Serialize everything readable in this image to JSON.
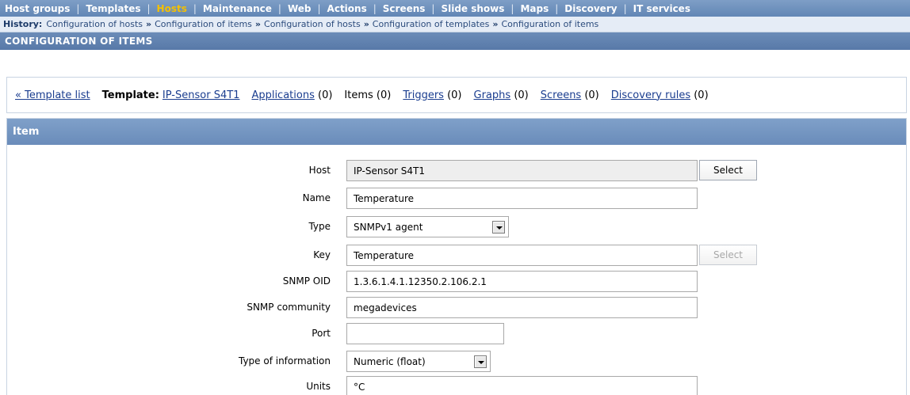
{
  "topnav": {
    "items": [
      "Host groups",
      "Templates",
      "Hosts",
      "Maintenance",
      "Web",
      "Actions",
      "Screens",
      "Slide shows",
      "Maps",
      "Discovery",
      "IT services"
    ],
    "active": "Hosts"
  },
  "history": {
    "title": "History:",
    "crumbs": [
      "Configuration of hosts",
      "Configuration of items",
      "Configuration of hosts",
      "Configuration of templates",
      "Configuration of items"
    ],
    "separator": "»"
  },
  "section_title": "CONFIGURATION OF ITEMS",
  "tabbar": {
    "back_link": "« Template list",
    "template_label": "Template:",
    "template_name": "IP-Sensor S4T1",
    "applications": "Applications",
    "applications_count": "(0)",
    "items": "Items (0)",
    "triggers": "Triggers",
    "triggers_count": "(0)",
    "graphs": "Graphs",
    "graphs_count": "(0)",
    "screens": "Screens",
    "screens_count": "(0)",
    "discovery_rules": "Discovery rules",
    "discovery_rules_count": "(0)"
  },
  "panel": {
    "title": "Item"
  },
  "form": {
    "host": {
      "label": "Host",
      "value": "IP-Sensor S4T1",
      "button": "Select"
    },
    "name": {
      "label": "Name",
      "value": "Temperature"
    },
    "type": {
      "label": "Type",
      "value": "SNMPv1 agent"
    },
    "key": {
      "label": "Key",
      "value": "Temperature",
      "button": "Select"
    },
    "snmp_oid": {
      "label": "SNMP OID",
      "value": "1.3.6.1.4.1.12350.2.106.2.1"
    },
    "snmp_community": {
      "label": "SNMP community",
      "value": "megadevices"
    },
    "port": {
      "label": "Port",
      "value": ""
    },
    "type_of_information": {
      "label": "Type of information",
      "value": "Numeric (float)"
    },
    "units": {
      "label": "Units",
      "value": "°C"
    }
  },
  "colors": {
    "nav_bg": "#6f92bd",
    "nav_active": "#f5c000",
    "history_bg": "#e5ecf6",
    "panel_header": "#7597c2"
  }
}
